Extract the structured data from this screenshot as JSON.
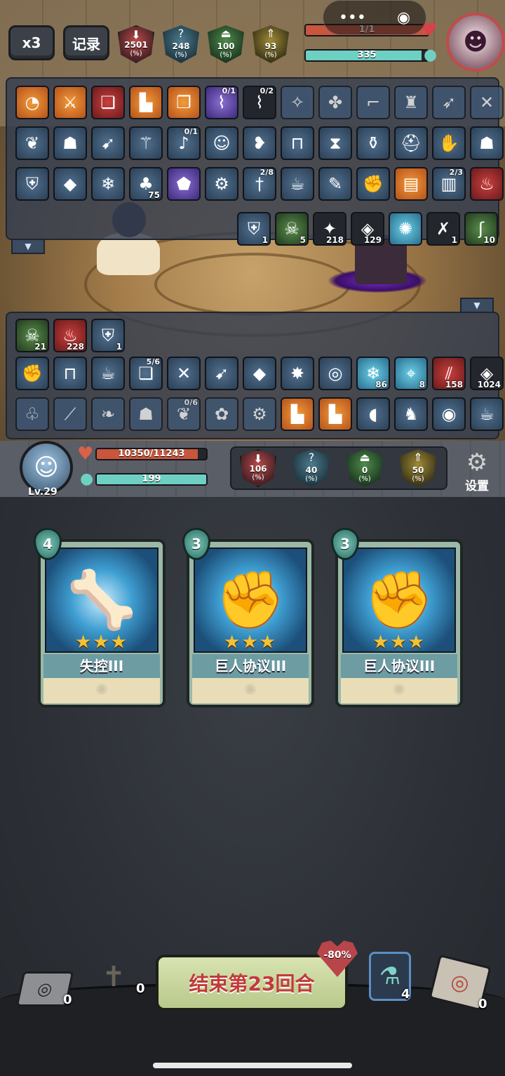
{
  "top_bar": {
    "speed_label": "x3",
    "record_label": "记录",
    "enemy_stats": [
      {
        "icon": "red-attack-icon",
        "value": "2501",
        "unit": "(%)"
      },
      {
        "icon": "blue-question-icon",
        "value": "248",
        "unit": "(%)"
      },
      {
        "icon": "green-defense-icon",
        "value": "100",
        "unit": "(%)"
      },
      {
        "icon": "gold-buff-icon",
        "value": "93",
        "unit": "(%)"
      }
    ],
    "enemy_shield": {
      "text": "1/1",
      "progress": 1.0
    },
    "enemy_energy": {
      "text": "335",
      "progress": 0.95
    },
    "mini_program": {
      "more": "•••",
      "close": "◉"
    }
  },
  "enemy_panel": {
    "rows": [
      [
        {
          "icon": "swirl-relic-icon",
          "style": "orange"
        },
        {
          "icon": "sword-relic-icon",
          "style": "orange"
        },
        {
          "icon": "scroll-relic-icon",
          "style": "red"
        },
        {
          "icon": "boot-relic-icon",
          "style": "orange"
        },
        {
          "icon": "parchment-relic-icon",
          "style": "orange"
        },
        {
          "icon": "spyglass-relic-icon",
          "style": "purple",
          "frac": "0/1"
        },
        {
          "icon": "telescope-relic-icon",
          "style": "dark",
          "frac": "0/2"
        },
        {
          "icon": "rune-relic-icon",
          "style": "ghost"
        },
        {
          "icon": "bundle-relic-icon",
          "style": "ghost"
        },
        {
          "icon": "pistols-relic-icon",
          "style": "ghost"
        },
        {
          "icon": "totem-relic-icon",
          "style": "ghost"
        },
        {
          "icon": "bow-relic-icon",
          "style": "ghost"
        },
        {
          "icon": "crossbow-relic-icon",
          "style": "ghost"
        }
      ],
      [
        {
          "icon": "wings-relic-icon",
          "style": "blue"
        },
        {
          "icon": "mask-relic-icon",
          "style": "blue"
        },
        {
          "icon": "kunai-relic-icon",
          "style": "blue"
        },
        {
          "icon": "staff-relic-icon",
          "style": "blue"
        },
        {
          "icon": "horn-relic-icon",
          "style": "blue",
          "frac": "0/1"
        },
        {
          "icon": "doll-relic-icon",
          "style": "blue"
        },
        {
          "icon": "fish-relic-icon",
          "style": "blue"
        },
        {
          "icon": "trap-relic-icon",
          "style": "blue"
        },
        {
          "icon": "hourglass-relic-icon",
          "style": "blue"
        },
        {
          "icon": "potion-relic-icon",
          "style": "blue"
        },
        {
          "icon": "helmet-relic-icon",
          "style": "blue"
        },
        {
          "icon": "gauntlet-relic-icon",
          "style": "blue"
        },
        {
          "icon": "golem-relic-icon",
          "style": "blue"
        }
      ],
      [
        {
          "icon": "shield-relic-icon",
          "style": "blue"
        },
        {
          "icon": "crystal-relic-icon",
          "style": "blue"
        },
        {
          "icon": "ice-crystal-relic-icon",
          "style": "blue"
        },
        {
          "icon": "mushroom-relic-icon",
          "style": "blue",
          "count": "75"
        },
        {
          "icon": "gem-relic-icon",
          "style": "purple"
        },
        {
          "icon": "cog-relic-icon",
          "style": "blue"
        },
        {
          "icon": "dagger-relic-icon",
          "style": "blue",
          "frac": "2/8"
        },
        {
          "icon": "teapot-relic-icon",
          "style": "blue"
        },
        {
          "icon": "brush-relic-icon",
          "style": "blue"
        },
        {
          "icon": "glove-relic-icon",
          "style": "blue"
        },
        {
          "icon": "book-relic-icon",
          "style": "orange"
        },
        {
          "icon": "tome-relic-icon",
          "style": "blue",
          "frac": "2/3"
        },
        {
          "icon": "fire-relic-icon",
          "style": "red"
        }
      ]
    ],
    "status_row": [
      {
        "icon": "block-shield-icon",
        "style": "blue",
        "count": "1"
      },
      {
        "icon": "poison-skull-icon",
        "style": "green",
        "count": "5"
      },
      {
        "icon": "strength-flash-icon",
        "style": "dark",
        "count": "218"
      },
      {
        "icon": "armor-die-icon",
        "style": "dark",
        "count": "129"
      },
      {
        "icon": "barrier-orb-icon",
        "style": "cyan",
        "count": ""
      },
      {
        "icon": "bone-icon",
        "style": "dark",
        "count": "1"
      },
      {
        "icon": "snake-icon",
        "style": "green",
        "count": "10"
      }
    ]
  },
  "player_panel": {
    "status_row": [
      {
        "icon": "poison-skull-icon",
        "style": "green",
        "count": "21"
      },
      {
        "icon": "rage-flame-icon",
        "style": "red",
        "count": "228"
      },
      {
        "icon": "block-shield-icon",
        "style": "blue",
        "count": "1"
      }
    ],
    "rows": [
      [
        {
          "icon": "glove-relic-icon",
          "style": "blue"
        },
        {
          "icon": "trap-relic-icon",
          "style": "blue"
        },
        {
          "icon": "teapot-relic-icon",
          "style": "blue"
        },
        {
          "icon": "scroll-relic-icon",
          "style": "blue",
          "frac": "5/6"
        },
        {
          "icon": "crossbow-relic-icon",
          "style": "blue"
        },
        {
          "icon": "kunai-relic-icon",
          "style": "blue"
        },
        {
          "icon": "crystals-relic-icon",
          "style": "blue"
        },
        {
          "icon": "firecracker-relic-icon",
          "style": "blue"
        },
        {
          "icon": "vortex-status-icon",
          "style": "blue"
        },
        {
          "icon": "frost-status-icon",
          "style": "cyan",
          "count": "86"
        },
        {
          "icon": "target-status-icon",
          "style": "cyan",
          "count": "8"
        },
        {
          "icon": "slash-status-icon",
          "style": "red",
          "count": "158"
        },
        {
          "icon": "armor-die-icon",
          "style": "dark",
          "count": "1024"
        }
      ],
      [
        {
          "icon": "tree-relic-icon",
          "style": "ghost"
        },
        {
          "icon": "wand-relic-icon",
          "style": "ghost"
        },
        {
          "icon": "leaf-relic-icon",
          "style": "ghost"
        },
        {
          "icon": "beast-relic-icon",
          "style": "ghost"
        },
        {
          "icon": "wing-relic-icon",
          "style": "ghost",
          "frac": "0/6"
        },
        {
          "icon": "rose-relic-icon",
          "style": "ghost"
        },
        {
          "icon": "gear-relic-icon",
          "style": "ghost"
        },
        {
          "icon": "boot-relic-icon",
          "style": "orange"
        },
        {
          "icon": "boot-relic-icon",
          "style": "orange"
        },
        {
          "icon": "bird-relic-icon",
          "style": "blue"
        },
        {
          "icon": "knight-relic-icon",
          "style": "blue"
        },
        {
          "icon": "owl-relic-icon",
          "style": "blue"
        },
        {
          "icon": "teapot-relic-icon",
          "style": "blue"
        }
      ]
    ]
  },
  "player": {
    "level": "Lv.29",
    "hp_text": "10350/11243",
    "hp_progress": 0.92,
    "energy_text": "199",
    "energy_progress": 1.0,
    "stats": [
      {
        "icon": "red-attack-icon",
        "value": "106",
        "unit": "(%)"
      },
      {
        "icon": "blue-question-icon",
        "value": "40",
        "unit": "(%)"
      },
      {
        "icon": "green-defense-icon",
        "value": "0",
        "unit": "(%)"
      },
      {
        "icon": "gold-buff-icon",
        "value": "50",
        "unit": "(%)"
      }
    ],
    "settings_label": "设置"
  },
  "cards": [
    {
      "cost": "4",
      "name": "失控III",
      "stars": "★★★",
      "art": "claw-card-art"
    },
    {
      "cost": "3",
      "name": "巨人协议III",
      "stars": "★★★",
      "art": "fist-card-art"
    },
    {
      "cost": "3",
      "name": "巨人协议III",
      "stars": "★★★",
      "art": "fist-card-art"
    }
  ],
  "bottom_bar": {
    "end_turn_label": "结束第23回合",
    "heart_badge": "-80%",
    "draw_pile_count": "0",
    "grave_count": "0",
    "potion_count": "4",
    "discard_pile_count": "0"
  },
  "colors": {
    "hp_fill": "#c9553c",
    "energy_fill": "#6ed0c2",
    "end_turn_text": "#c23a3a",
    "star": "#f3c237"
  }
}
